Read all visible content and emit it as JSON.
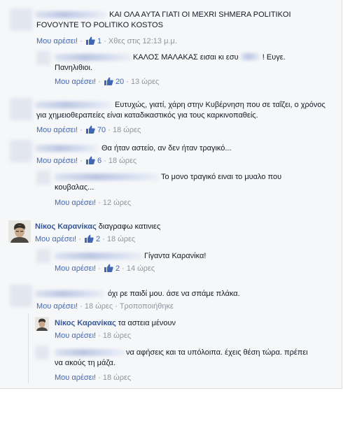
{
  "labels": {
    "like": "Μου αρέσει!",
    "sep": "·",
    "edited": "Τροποποιήθηκε"
  },
  "comments": [
    {
      "text": "ΚΑΙ ΟΛΑ ΑΥΤΑ ΓΙΑΤΙ ΟΙ ΜΕΧRI SHMERA POLITIKOI FOVOYNTE TO POLITIKO KOSTOS",
      "likes": "1",
      "time": "Χθες στις 12:13 μ.μ."
    },
    {
      "text_a": "ΚΑΛΟΣ ΜΑΛΑΚΑΣ εισαι κι εσυ",
      "text_b": "! Ευγε.",
      "text_c": "Πανηλιθιοι.",
      "likes": "20",
      "time": "13 ώρες"
    },
    {
      "text": "Ευτυχώς, γιατί, χάρη στην Κυβέρνηση που σε ταΐζει, ο χρόνος για χημειοθεραπείες είναι καταδικαστικός για τους καρκινοπαθείς.",
      "likes": "70",
      "time": "18 ώρες"
    },
    {
      "text": "Θα ήταν αστείο, αν δεν ήταν τραγικό...",
      "likes": "6",
      "time": "18 ώρες"
    },
    {
      "text_a": "Το μονο τραγικό ειναι το μυαλο που",
      "text_b": "κουβαλας...",
      "time": "12 ώρες"
    },
    {
      "author": "Νίκος Καρανίκας",
      "text": "διαγραφω κατινιες",
      "likes": "2",
      "time": "18 ώρες"
    },
    {
      "text": "Γίγαντα Καρανίκα!",
      "likes": "2",
      "time": "14 ώρες"
    },
    {
      "text": "όχι ρε παιδί μου. άσε να σπάμε πλάκα.",
      "time": "18 ώρες"
    },
    {
      "author": "Νίκος Καρανίκας",
      "text": "τα αστεια μένουν",
      "time": "18 ώρες"
    },
    {
      "text_a": "να αφήσεις και τα υπόλοιπα. έχεις θέση τώρα. πρέπει",
      "text_b": "να ακούς τη μάζα.",
      "time": "18 ώρες"
    }
  ],
  "colors": {
    "link": "#4267b2",
    "name": "#365899",
    "meta": "#90949c",
    "text": "#141823"
  },
  "icons": {
    "like": "thumbs-up-icon"
  }
}
